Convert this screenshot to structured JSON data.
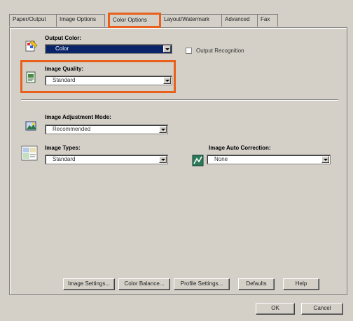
{
  "tabs": [
    {
      "label": "Paper/Output"
    },
    {
      "label": "Image Options"
    },
    {
      "label": "Color Options"
    },
    {
      "label": "Layout/Watermark"
    },
    {
      "label": "Advanced"
    },
    {
      "label": "Fax"
    }
  ],
  "output_color": {
    "label": "Output Color:",
    "value": "Color"
  },
  "output_recognition": {
    "label": "Output Recognition",
    "checked": false
  },
  "image_quality": {
    "label": "Image Quality:",
    "value": "Standard"
  },
  "image_adjustment_mode": {
    "label": "Image Adjustment Mode:",
    "value": "Recommended"
  },
  "image_types": {
    "label": "Image Types:",
    "value": "Standard"
  },
  "image_auto_correction": {
    "label": "Image Auto Correction:",
    "value": "None"
  },
  "buttons": {
    "image_settings": "Image Settings...",
    "color_balance": "Color Balance...",
    "profile_settings": "Profile Settings...",
    "defaults": "Defaults",
    "help": "Help"
  },
  "footer": {
    "ok": "OK",
    "cancel": "Cancel"
  },
  "colors": {
    "highlight": "#e8601c",
    "dialog_bg": "#d4d0c8",
    "selection": "#0a246a"
  }
}
